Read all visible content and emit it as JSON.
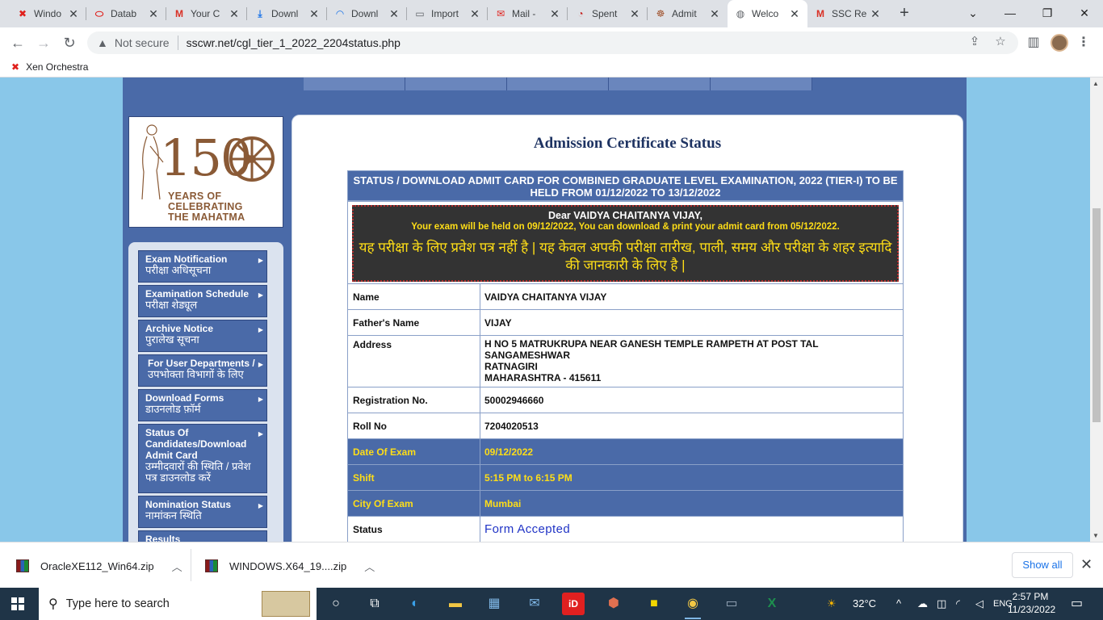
{
  "browser": {
    "tabs": [
      {
        "title": "Windo",
        "icon": "xen-icon"
      },
      {
        "title": "Datab",
        "icon": "oracle-icon"
      },
      {
        "title": "Your C",
        "icon": "gmail-icon"
      },
      {
        "title": "Downl",
        "icon": "download-icon"
      },
      {
        "title": "Downl",
        "icon": "loading-icon"
      },
      {
        "title": "Import",
        "icon": "page-icon"
      },
      {
        "title": "Mail -",
        "icon": "mail-icon"
      },
      {
        "title": "Spent",
        "icon": "speedometer-icon"
      },
      {
        "title": "Admit",
        "icon": "emblem-icon"
      },
      {
        "title": "Welco",
        "icon": "globe-icon"
      },
      {
        "title": "SSC Re",
        "icon": "gmail-icon"
      }
    ],
    "active_tab": 9,
    "security_label": "Not secure",
    "url": "sscwr.net/cgl_tier_1_2022_2204status.php",
    "bookmark": "Xen Orchestra"
  },
  "page": {
    "title": "Admission Certificate Status",
    "header_bar": "STATUS / DOWNLOAD ADMIT CARD FOR COMBINED GRADUATE LEVEL EXAMINATION, 2022 (TIER-I) TO BE HELD FROM 01/12/2022 TO 13/12/2022",
    "notice": {
      "greeting": "Dear VAIDYA CHAITANYA VIJAY,",
      "exam_line": "Your exam will be held on 09/12/2022, You can download & print your admit card from 05/12/2022.",
      "hindi": "यह परीक्षा के लिए प्रवेश पत्र नहीं है | यह केवल अपकी परीक्षा तारीख, पाली, समय और परीक्षा के शहर इत्यादि की जानकारी के लिए है |"
    },
    "fields": {
      "name_label": "Name",
      "name": "VAIDYA CHAITANYA VIJAY",
      "father_label": "Father's Name",
      "father": "VIJAY",
      "address_label": "Address",
      "address_line1": "H NO 5 MATRUKRUPA NEAR GANESH TEMPLE RAMPETH AT POST TAL",
      "address_line2": "SANGAMESHWAR",
      "address_line3": "RATNAGIRI",
      "address_line4": "MAHARASHTRA - 415611",
      "reg_label": "Registration No.",
      "reg": "50002946660",
      "roll_label": "Roll No",
      "roll": "7204020513",
      "date_label": "Date Of Exam",
      "date": "09/12/2022",
      "shift_label": "Shift",
      "shift": "5:15 PM to 6:15 PM",
      "city_label": "City Of Exam",
      "city": "Mumbai",
      "status_label": "Status",
      "status": "Form Accepted"
    }
  },
  "logo": {
    "number": "150",
    "line1": "YEARS OF",
    "line2": "CELEBRATING",
    "line3": "THE MAHATMA"
  },
  "sidebar": [
    {
      "en": "Exam Notification",
      "hi": "परीक्षा अधिसूचना"
    },
    {
      "en": "Examination Schedule",
      "hi": "परीक्षा शेड्यूल"
    },
    {
      "en": "Archive Notice",
      "hi": "पुरालेख सूचना"
    },
    {
      "en": "For User Departments /",
      "hi": "उपभोक्ता विभागों के लिए"
    },
    {
      "en": "Download Forms",
      "hi": "डाउनलोड फ़ॉर्म"
    },
    {
      "en": "Status Of Candidates/Download Admit Card",
      "hi": "उम्मीदवारों की स्थिति / प्रवेश पत्र डाउनलोड करें"
    },
    {
      "en": "Nomination Status",
      "hi": "नामांकन स्थिति"
    },
    {
      "en": "Results",
      "hi": ""
    }
  ],
  "downloads": {
    "items": [
      "OracleXE112_Win64.zip",
      "WINDOWS.X64_19....zip"
    ],
    "show_all": "Show all"
  },
  "taskbar": {
    "search_placeholder": "Type here to search",
    "temperature": "32°C",
    "time": "2:57 PM",
    "date": "11/23/2022"
  },
  "colors": {
    "accent_blue": "#4a6aa8",
    "notice_yellow": "#ffde17",
    "page_bg": "#89c7e9",
    "status_blue": "#2134c6"
  }
}
